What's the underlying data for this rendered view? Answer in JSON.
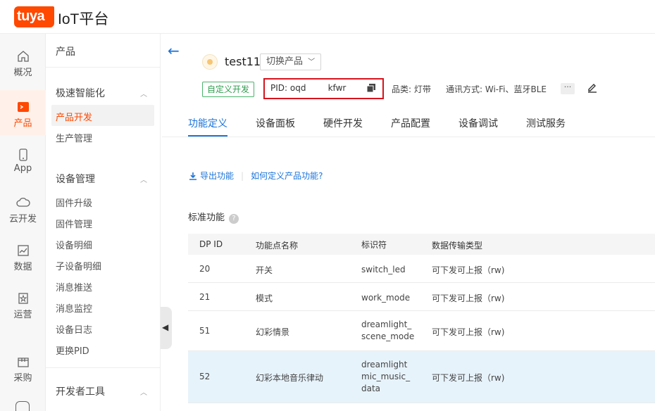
{
  "header": {
    "logo_text": "tuya",
    "platform_name": "IoT平台"
  },
  "rail": {
    "items": [
      {
        "label": "概况",
        "icon": "home-icon"
      },
      {
        "label": "产品",
        "icon": "product-icon",
        "active": true
      },
      {
        "label": "App",
        "icon": "phone-icon"
      },
      {
        "label": "云开发",
        "icon": "cloud-icon"
      },
      {
        "label": "数据",
        "icon": "chart-icon"
      },
      {
        "label": "运营",
        "icon": "operation-icon"
      },
      {
        "label": "采购",
        "icon": "store-icon"
      }
    ]
  },
  "menu": {
    "title": "产品",
    "group1": "极速智能化",
    "group1_items": [
      "产品开发",
      "生产管理"
    ],
    "group2": "设备管理",
    "group2_items": [
      "固件升级",
      "固件管理",
      "设备明细",
      "子设备明细",
      "消息推送",
      "消息监控",
      "设备日志",
      "更换PID"
    ],
    "group3": "开发者工具"
  },
  "product": {
    "name": "test11",
    "switch_label": "切换产品",
    "tag": "自定义开发",
    "pid": "PID: oqd             kfwr",
    "category": "品类: 灯带",
    "protocol": "通讯方式: Wi-Fi、蓝牙BLE",
    "more": "···"
  },
  "tabs": [
    "功能定义",
    "设备面板",
    "硬件开发",
    "产品配置",
    "设备调试",
    "测试服务"
  ],
  "links": {
    "export": "导出功能",
    "help": "如何定义产品功能?"
  },
  "section": {
    "title": "标准功能",
    "help_icon": "?"
  },
  "table": {
    "headers": [
      "DP ID",
      "功能点名称",
      "标识符",
      "数据传输类型"
    ],
    "rows": [
      {
        "id": "20",
        "name": "开关",
        "identifier": "switch_led",
        "type": "可下发可上报（rw)"
      },
      {
        "id": "21",
        "name": "模式",
        "identifier": "work_mode",
        "type": "可下发可上报（rw)"
      },
      {
        "id": "51",
        "name": "幻彩情景",
        "identifier": "dreamlight_scene_mode",
        "type": "可下发可上报（rw)"
      },
      {
        "id": "52",
        "name": "幻彩本地音乐律动",
        "identifier": "dreamlightmic_music_data",
        "type": "可下发可上报（rw)"
      }
    ]
  },
  "colors": {
    "brand": "#ff4800",
    "link": "#1a73d9",
    "highlight_row": "#e7f3fb",
    "pid_border": "#d5141d"
  }
}
